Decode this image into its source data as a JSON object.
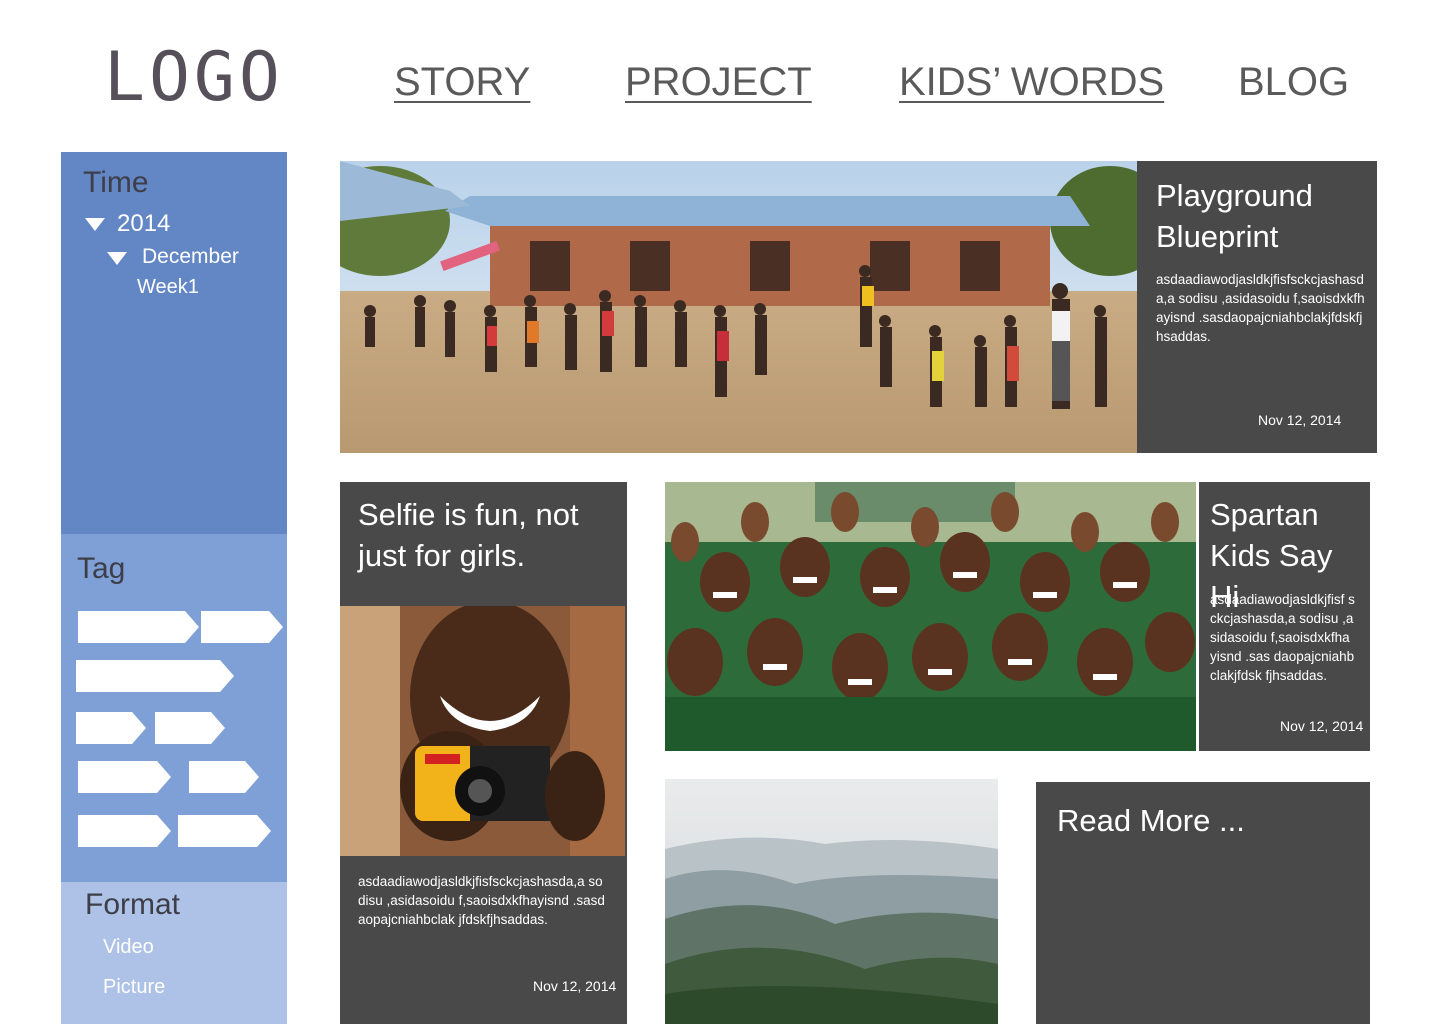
{
  "header": {
    "logo": "LOGO",
    "nav": [
      {
        "label": "STORY"
      },
      {
        "label": "PROJECT"
      },
      {
        "label": "KIDS’ WORDS"
      },
      {
        "label": "BLOG"
      }
    ]
  },
  "sidebar": {
    "time": {
      "heading": "Time",
      "year": "2014",
      "month": "December",
      "week": "Week1"
    },
    "tag": {
      "heading": "Tag"
    },
    "format": {
      "heading": "Format",
      "items": [
        "Video",
        "Picture"
      ]
    }
  },
  "posts": {
    "featured": {
      "title_line1": "Playground",
      "title_line2": "Blueprint",
      "body": "asdaadiawodjasldkjfisfsckcjashasda,a sodisu ,asidasoidu f,saoisdxkfhayisnd .sasdaopajcniahbclakjfdskfjhsaddas.",
      "date": "Nov 12, 2014"
    },
    "selfie": {
      "title_line1": "Selfie is fun, not",
      "title_line2": "just for girls.",
      "body": "asdaadiawodjasldkjfisfsckcjashasda,a sodisu ,asidasoidu f,saoisdxkfhayisnd .sasdaopajcniahbclak jfdskfjhsaddas.",
      "date": "Nov 12, 2014"
    },
    "spartan": {
      "title_line1": "Spartan",
      "title_line2": "Kids Say Hi",
      "body": "asdaadiawodjasldkjfisf sckcjashasda,a sodisu ,asidasoidu f,saoisdxkfhayisnd .sas daopajcniahbclakjfdsk fjhsaddas.",
      "date": "Nov 12, 2014"
    },
    "read_more": {
      "label": "Read More ..."
    }
  },
  "colors": {
    "time_panel": "#6287c4",
    "tag_panel": "#7fa0d7",
    "format_panel": "#adc2e6",
    "card": "#494949"
  }
}
